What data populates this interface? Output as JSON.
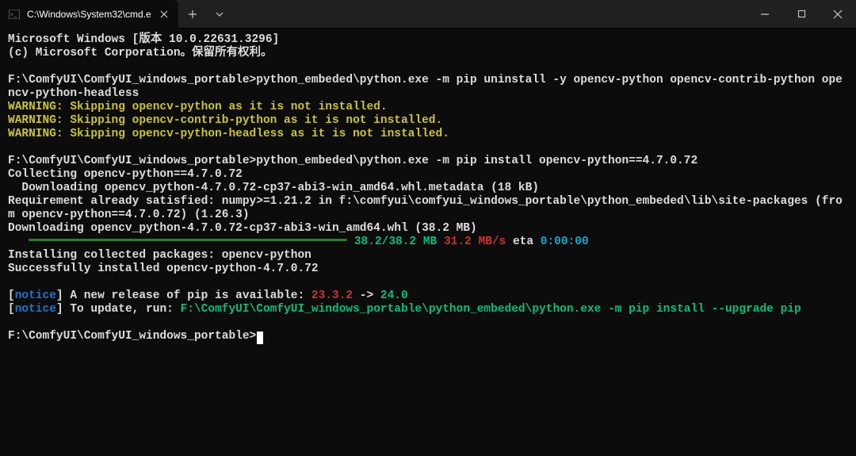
{
  "titlebar": {
    "tab_title": "C:\\Windows\\System32\\cmd.e"
  },
  "content": {
    "l1": "Microsoft Windows [版本 10.0.22631.3296]",
    "l2": "(c) Microsoft Corporation。保留所有权利。",
    "l3a": "F:\\ComfyUI\\ComfyUI_windows_portable>",
    "l3b": "python_embeded\\python.exe -m pip uninstall -y opencv-python opencv-contrib-python opencv-python-headless",
    "w1": "WARNING: Skipping opencv-python as it is not installed.",
    "w2": "WARNING: Skipping opencv-contrib-python as it is not installed.",
    "w3": "WARNING: Skipping opencv-python-headless as it is not installed.",
    "l4a": "F:\\ComfyUI\\ComfyUI_windows_portable>",
    "l4b": "python_embeded\\python.exe -m pip install opencv-python==4.7.0.72",
    "l5": "Collecting opencv-python==4.7.0.72",
    "l6": "  Downloading opencv_python-4.7.0.72-cp37-abi3-win_amd64.whl.metadata (18 kB)",
    "l7": "Requirement already satisfied: numpy>=1.21.2 in f:\\comfyui\\comfyui_windows_portable\\python_embeded\\lib\\site-packages (from opencv-python==4.7.0.72) (1.26.3)",
    "l8": "Downloading opencv_python-4.7.0.72-cp37-abi3-win_amd64.whl (38.2 MB)",
    "prog_done": "38.2/38.2 MB",
    "prog_speed": "31.2 MB/s",
    "prog_eta_lbl": " eta ",
    "prog_eta": "0:00:00",
    "l9": "Installing collected packages: opencv-python",
    "l10": "Successfully installed opencv-python-4.7.0.72",
    "n1_open": "[",
    "n1_tag": "notice",
    "n1_close": "]",
    "n1_text": " A new release of pip is available: ",
    "n1_old": "23.3.2",
    "n1_arrow": " -> ",
    "n1_new": "24.0",
    "n2_open": "[",
    "n2_tag": "notice",
    "n2_close": "]",
    "n2_text": " To update, run: ",
    "n2_cmd": "F:\\ComfyUI\\ComfyUI_windows_portable\\python_embeded\\python.exe -m pip install --upgrade pip",
    "prompt_last": "F:\\ComfyUI\\ComfyUI_windows_portable>"
  }
}
